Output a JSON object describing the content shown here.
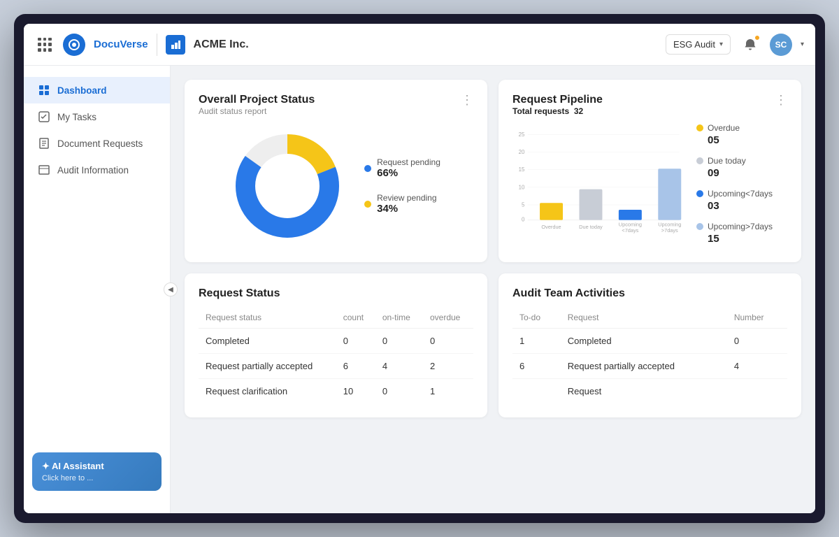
{
  "header": {
    "app_name": "DocuVerse",
    "company": "ACME Inc.",
    "audit_selector": "ESG Audit",
    "user_initials": "SC"
  },
  "sidebar": {
    "collapse_icon": "◀",
    "items": [
      {
        "id": "dashboard",
        "label": "Dashboard",
        "icon": "▦",
        "active": true
      },
      {
        "id": "my-tasks",
        "label": "My Tasks",
        "icon": "☑",
        "active": false
      },
      {
        "id": "document-requests",
        "label": "Document Requests",
        "icon": "☰",
        "active": false
      },
      {
        "id": "audit-information",
        "label": "Audit Information",
        "icon": "📖",
        "active": false
      }
    ],
    "ai_assistant": {
      "title": "✦ AI Assistant",
      "subtitle": "Click here to ..."
    }
  },
  "overall_project_status": {
    "title": "Overall Project Status",
    "subtitle": "Audit status report",
    "legend": [
      {
        "label": "Request pending",
        "pct": "66%",
        "color": "#2979e8"
      },
      {
        "label": "Review pending",
        "pct": "34%",
        "color": "#f5c518"
      }
    ],
    "donut": {
      "pending_deg": 237.6,
      "review_deg": 122.4
    }
  },
  "request_pipeline": {
    "title": "Request Pipeline",
    "subtitle_prefix": "Total requests",
    "total": "32",
    "bars": [
      {
        "label": "Overdue",
        "value": 5,
        "color": "#f5c518",
        "max": 25
      },
      {
        "label": "Due today",
        "value": 9,
        "color": "#c8cdd6",
        "max": 25
      },
      {
        "label": "Upcoming\n<7days",
        "value": 3,
        "color": "#2979e8",
        "max": 25
      },
      {
        "label": "Upcoming\n>7days",
        "value": 15,
        "color": "#a8c4e8",
        "max": 25
      }
    ],
    "y_axis": [
      0,
      5,
      10,
      15,
      20,
      25
    ],
    "legend": [
      {
        "label": "Overdue",
        "value": "05",
        "color": "#f5c518"
      },
      {
        "label": "Due today",
        "value": "09",
        "color": "#c8cdd6"
      },
      {
        "label": "Upcoming<7days",
        "value": "03",
        "color": "#2979e8"
      },
      {
        "label": "Upcoming>7days",
        "value": "15",
        "color": "#a8c4e8"
      }
    ]
  },
  "request_status": {
    "title": "Request Status",
    "columns": [
      "Request status",
      "count",
      "on-time",
      "overdue"
    ],
    "rows": [
      {
        "status": "Completed",
        "count": "0",
        "on_time": "0",
        "overdue": "0"
      },
      {
        "status": "Request partially accepted",
        "count": "6",
        "on_time": "4",
        "overdue": "2"
      },
      {
        "status": "Request clarification",
        "count": "10",
        "on_time": "0",
        "overdue": "1"
      }
    ]
  },
  "audit_team_activities": {
    "title": "Audit Team Activities",
    "columns": [
      "To-do",
      "Request",
      "Number"
    ],
    "rows": [
      {
        "todo": "1",
        "request": "Completed",
        "number": "0"
      },
      {
        "todo": "6",
        "request": "Request partially accepted",
        "number": "4"
      },
      {
        "todo": "",
        "request": "Request",
        "number": ""
      }
    ]
  }
}
